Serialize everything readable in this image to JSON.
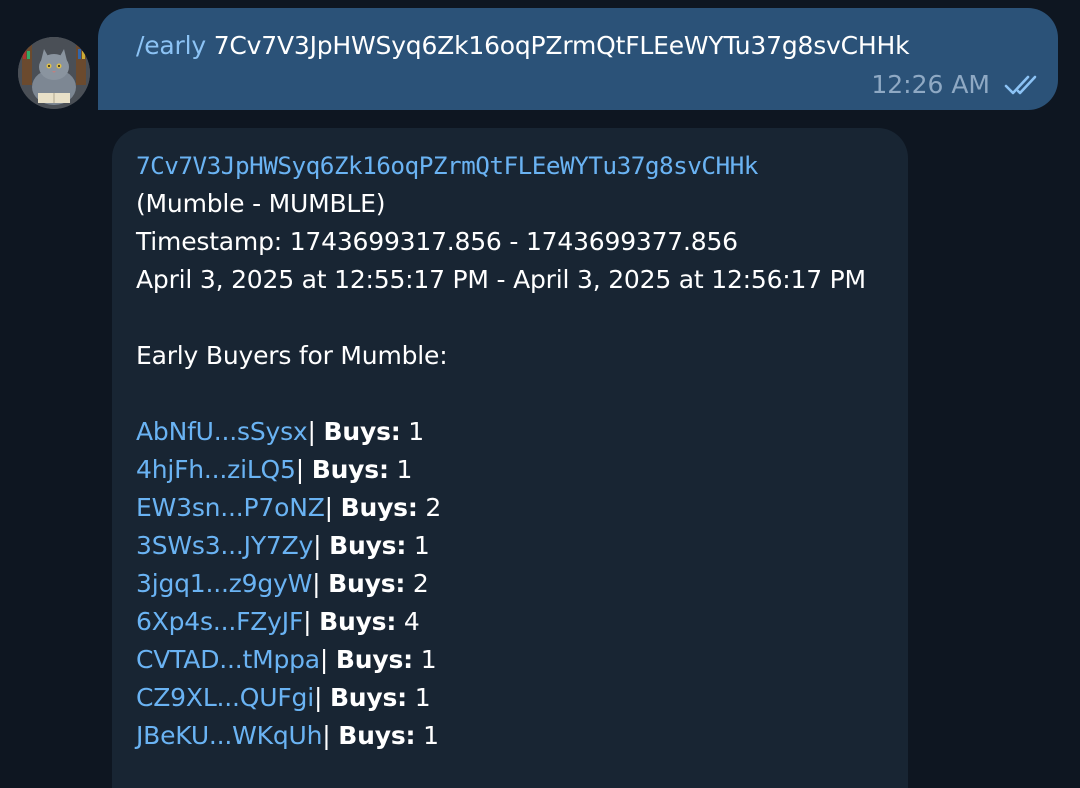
{
  "outgoing": {
    "command": "/early",
    "argument": "7Cv7V3JpHWSyq6Zk16oqPZrmQtFLEeWYTu37g8svCHHk",
    "time": "12:26 AM",
    "status_icon": "double-check-icon"
  },
  "incoming": {
    "token_address": "7Cv7V3JpHWSyq6Zk16oqPZrmQtFLEeWYTu37g8svCHHk",
    "token_name": "(Mumble - MUMBLE)",
    "timestamp": "Timestamp: 1743699317.856 - 1743699377.856",
    "date_range": "April 3, 2025 at 12:55:17 PM - April 3, 2025 at 12:56:17 PM",
    "header": "Early Buyers for Mumble:",
    "buys_label": "Buys:",
    "buyers": [
      {
        "address": "AbNfU...sSysx",
        "buys": "1"
      },
      {
        "address": "4hjFh...ziLQ5",
        "buys": "1"
      },
      {
        "address": "EW3sn...P7oNZ",
        "buys": "2"
      },
      {
        "address": "3SWs3...JY7Zy",
        "buys": "1"
      },
      {
        "address": "3jgq1...z9gyW",
        "buys": "2"
      },
      {
        "address": "6Xp4s...FZyJF",
        "buys": "4"
      },
      {
        "address": "CVTAD...tMppa",
        "buys": "1"
      },
      {
        "address": "CZ9XL...QUFgi",
        "buys": "1"
      },
      {
        "address": "JBeKU...WKqUh",
        "buys": "1"
      }
    ]
  },
  "colors": {
    "background": "#0e1621",
    "outgoing_bubble": "#2b5278",
    "incoming_bubble": "#182533",
    "link": "#6ab3f3",
    "command": "#8cc3f5"
  }
}
